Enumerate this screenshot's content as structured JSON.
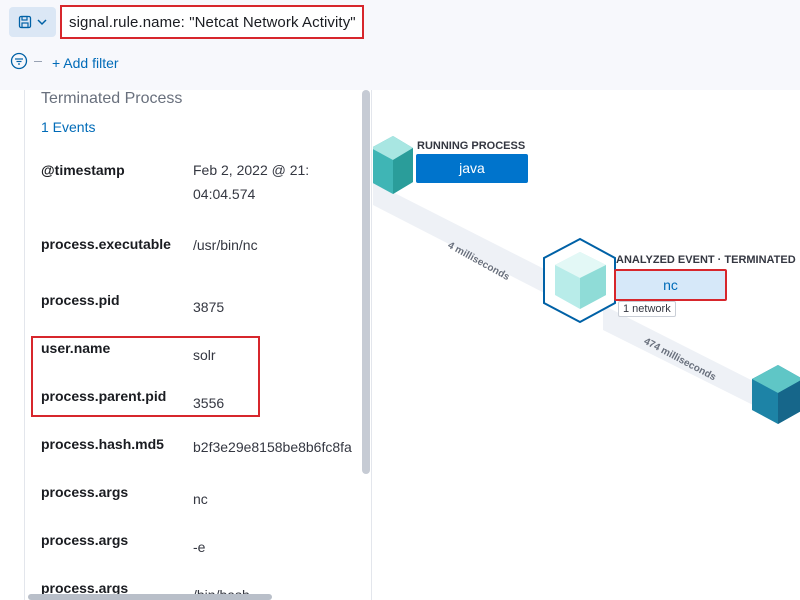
{
  "query_bar": {
    "query": "signal.rule.name: \"Netcat Network Activity\"",
    "add_filter_label": "+ Add filter",
    "save_icon": "save-icon",
    "chevron_icon": "chevron-down-icon",
    "filter_icon": "filter-icon"
  },
  "details_panel": {
    "title": "Terminated Process",
    "events_link": "1 Events",
    "fields": [
      {
        "key": "@timestamp",
        "value": "Feb 2, 2022 @ 21: 04:04.574"
      },
      {
        "key": "process.executable",
        "value": "/usr/bin/nc"
      },
      {
        "key": "process.pid",
        "value": "3875"
      },
      {
        "key": "user.name",
        "value": "solr"
      },
      {
        "key": "process.parent.pid",
        "value": "3556"
      },
      {
        "key": "process.hash.md5",
        "value": "b2f3e29e8158be8b6fc8fa"
      },
      {
        "key": "process.args",
        "value": "nc"
      },
      {
        "key": "process.args",
        "value": "-e"
      },
      {
        "key": "process.args",
        "value": "/bin/bash"
      }
    ]
  },
  "graph": {
    "running_node": {
      "label": "RUNNING PROCESS",
      "name": "java"
    },
    "analyzed_node": {
      "label": "ANALYZED EVENT · TERMINATED",
      "name": "nc",
      "badge": "1 network"
    },
    "edge_1": "4 milliseconds",
    "edge_2": "474 milliseconds",
    "colors": {
      "accent": "#0074cc",
      "highlight": "#d7262c",
      "cube_teal": "#3fb5b5"
    }
  }
}
